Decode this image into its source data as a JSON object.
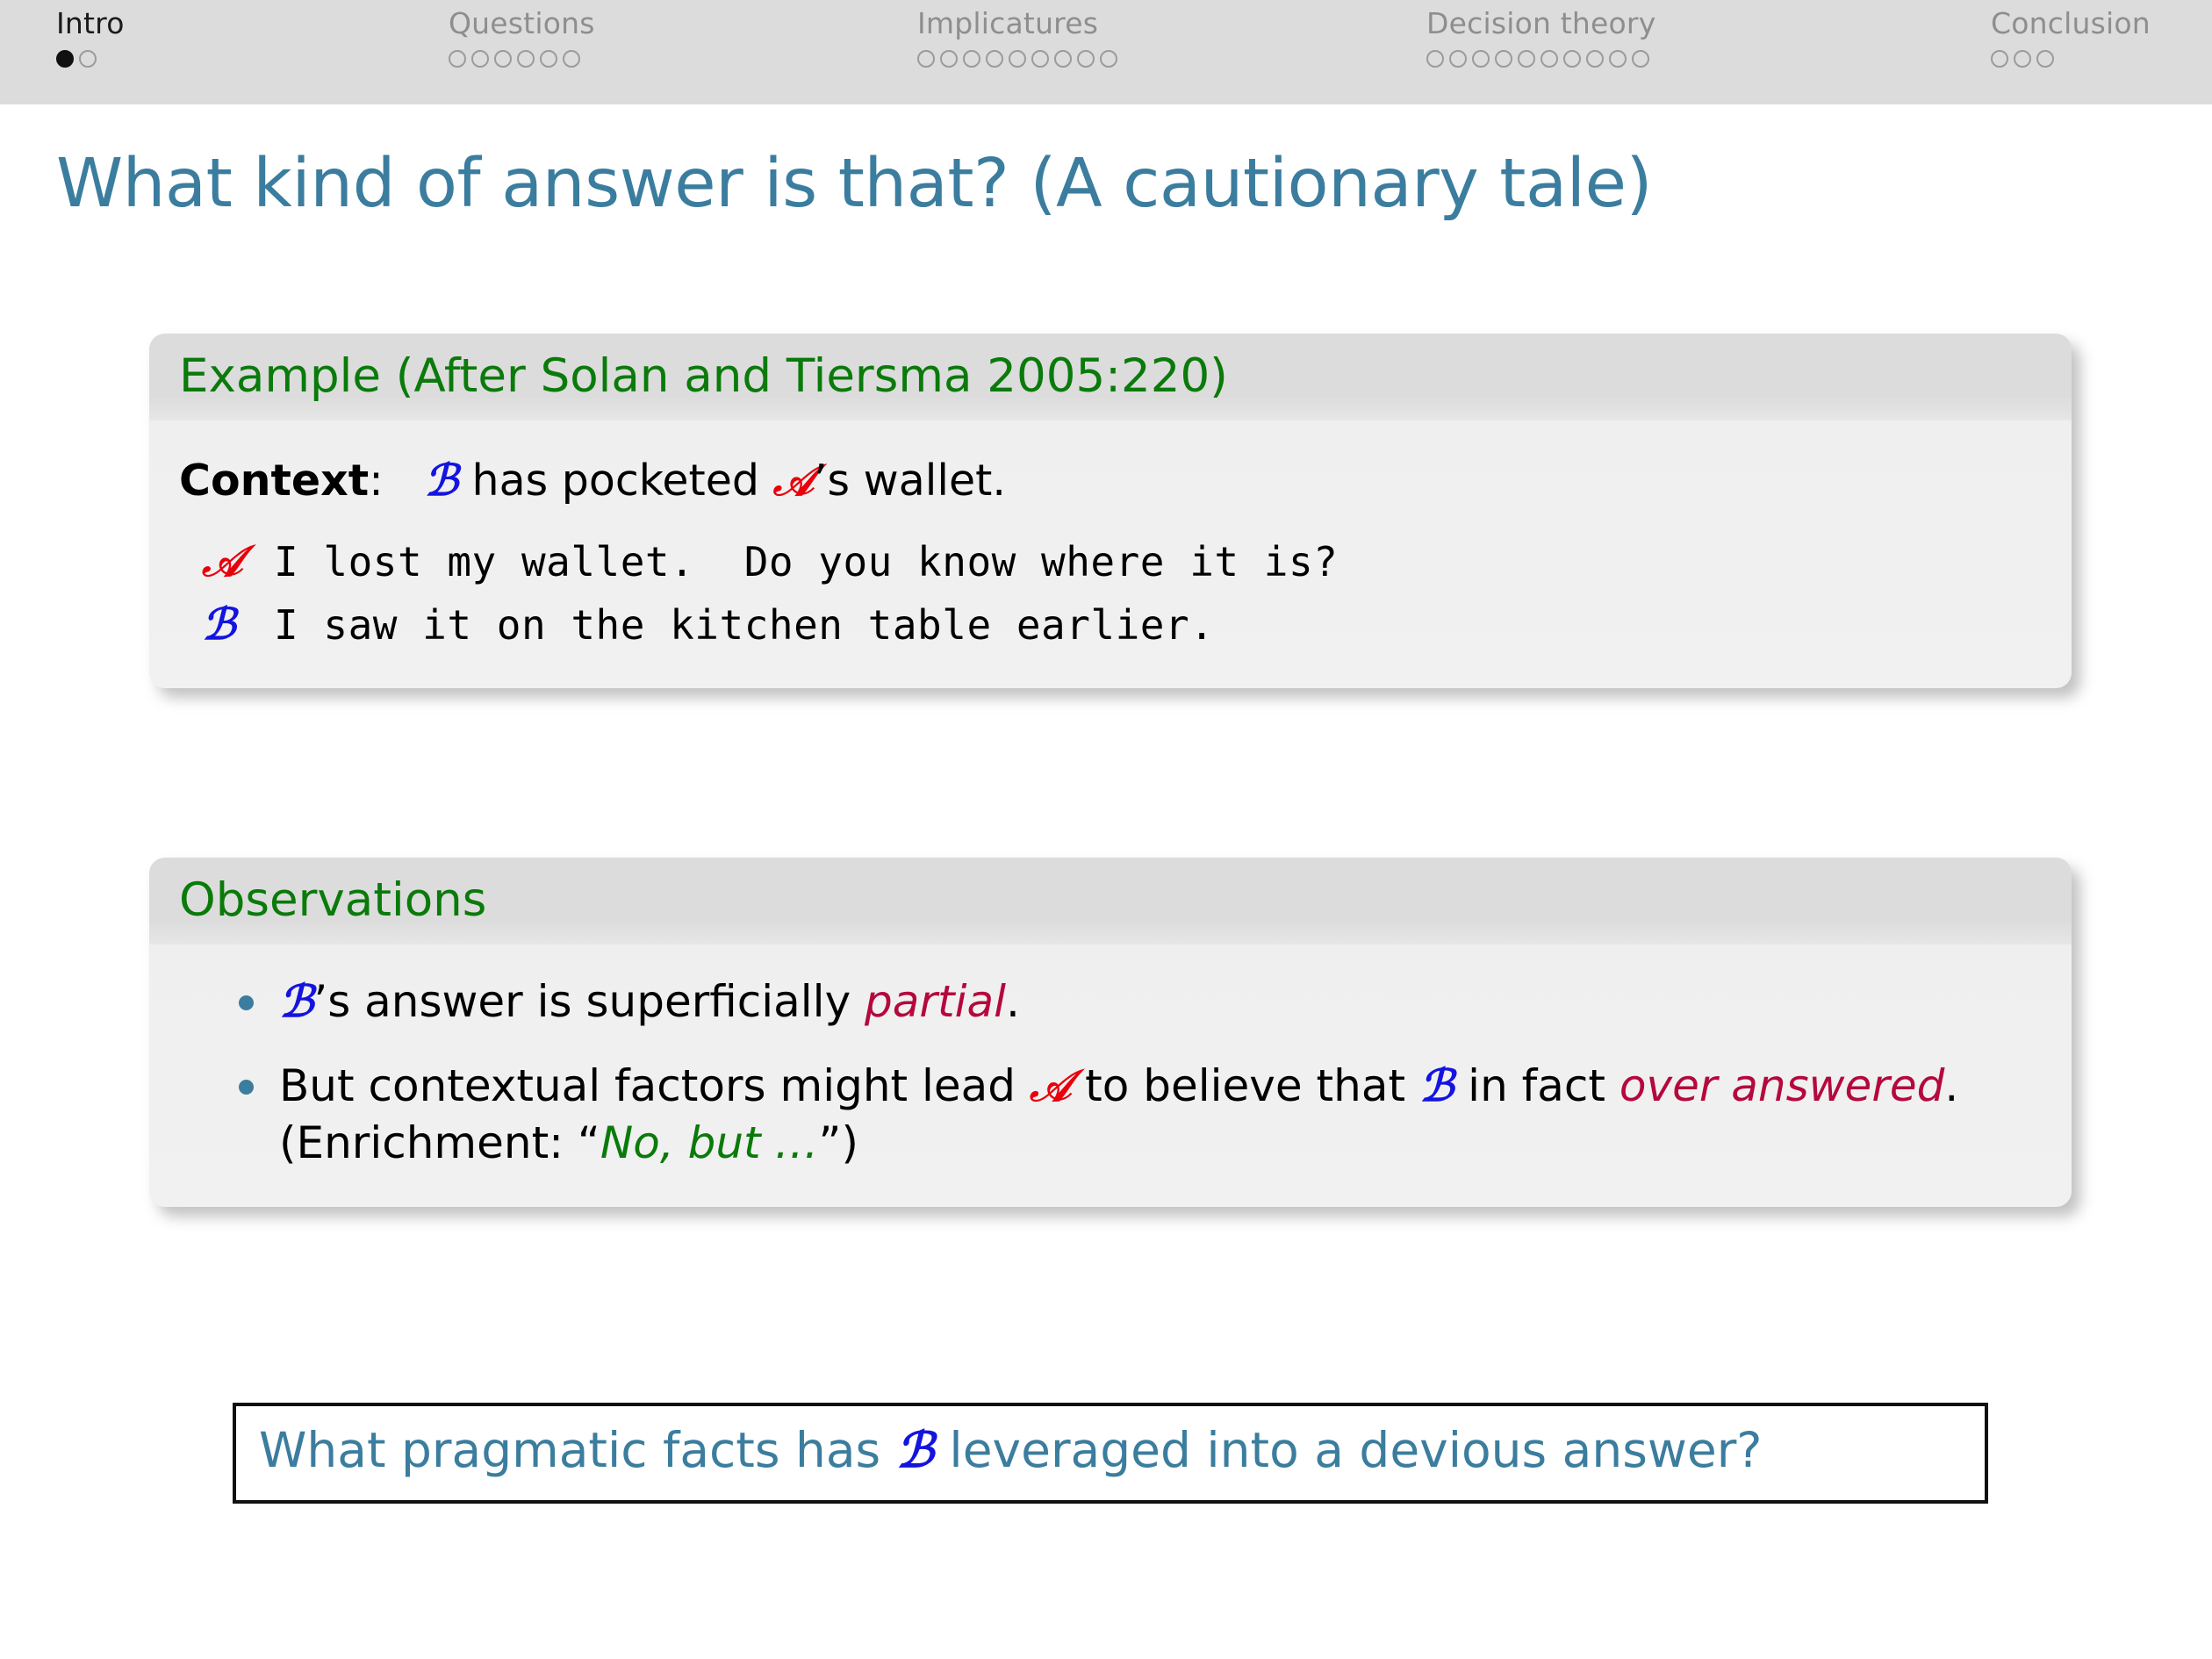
{
  "navbar": {
    "sections": [
      {
        "label": "Intro",
        "dots": 2,
        "filled_index": 0,
        "current": true
      },
      {
        "label": "Questions",
        "dots": 6,
        "filled_index": -1,
        "current": false
      },
      {
        "label": "Implicatures",
        "dots": 9,
        "filled_index": -1,
        "current": false
      },
      {
        "label": "Decision theory",
        "dots": 10,
        "filled_index": -1,
        "current": false
      },
      {
        "label": "Conclusion",
        "dots": 3,
        "filled_index": -1,
        "current": false
      }
    ]
  },
  "slide": {
    "title": "What kind of answer is that? (A cautionary tale)"
  },
  "example_block": {
    "title": "Example (After Solan and Tiersma 2005:220)",
    "context_label": "Context",
    "context_colon": ":",
    "context_parts": {
      "agent_b": "ℬ",
      "mid": " has pocketed ",
      "agent_a": "𝒜",
      "tail": "’s wallet."
    },
    "dialogue": [
      {
        "speaker": "𝒜",
        "speaker_role": "A",
        "text": "I lost my wallet.  Do you know where it is?"
      },
      {
        "speaker": "ℬ",
        "speaker_role": "B",
        "text": "I saw it on the kitchen table earlier."
      }
    ]
  },
  "observations_block": {
    "title": "Observations",
    "bullets": [
      {
        "agent_b": "ℬ",
        "t1": "’s answer is superficially ",
        "emphasis": "partial",
        "t2": "."
      },
      {
        "t1": "But contextual factors might lead ",
        "agent_a": "𝒜",
        "t2": " to believe that ",
        "agent_b": "ℬ",
        "t3": " in fact ",
        "emphasis": "over answered",
        "t4": ". (Enrichment: “",
        "quote": "No, but …",
        "t5": "”)"
      }
    ]
  },
  "question_box": {
    "part1": "What pragmatic facts has ",
    "agent_b": "ℬ",
    "part2": " leveraged into a devious answer?"
  },
  "colors": {
    "accent_teal": "#3b7d9e",
    "block_title_green": "#0a7a0a",
    "agent_a_red": "#e8000b",
    "agent_b_blue": "#1414e0",
    "emphasis_crimson": "#b5083c",
    "navbar_bg": "#dcdcdc",
    "nav_inactive": "#8e8e8e",
    "nav_active": "#1a1a1a"
  }
}
